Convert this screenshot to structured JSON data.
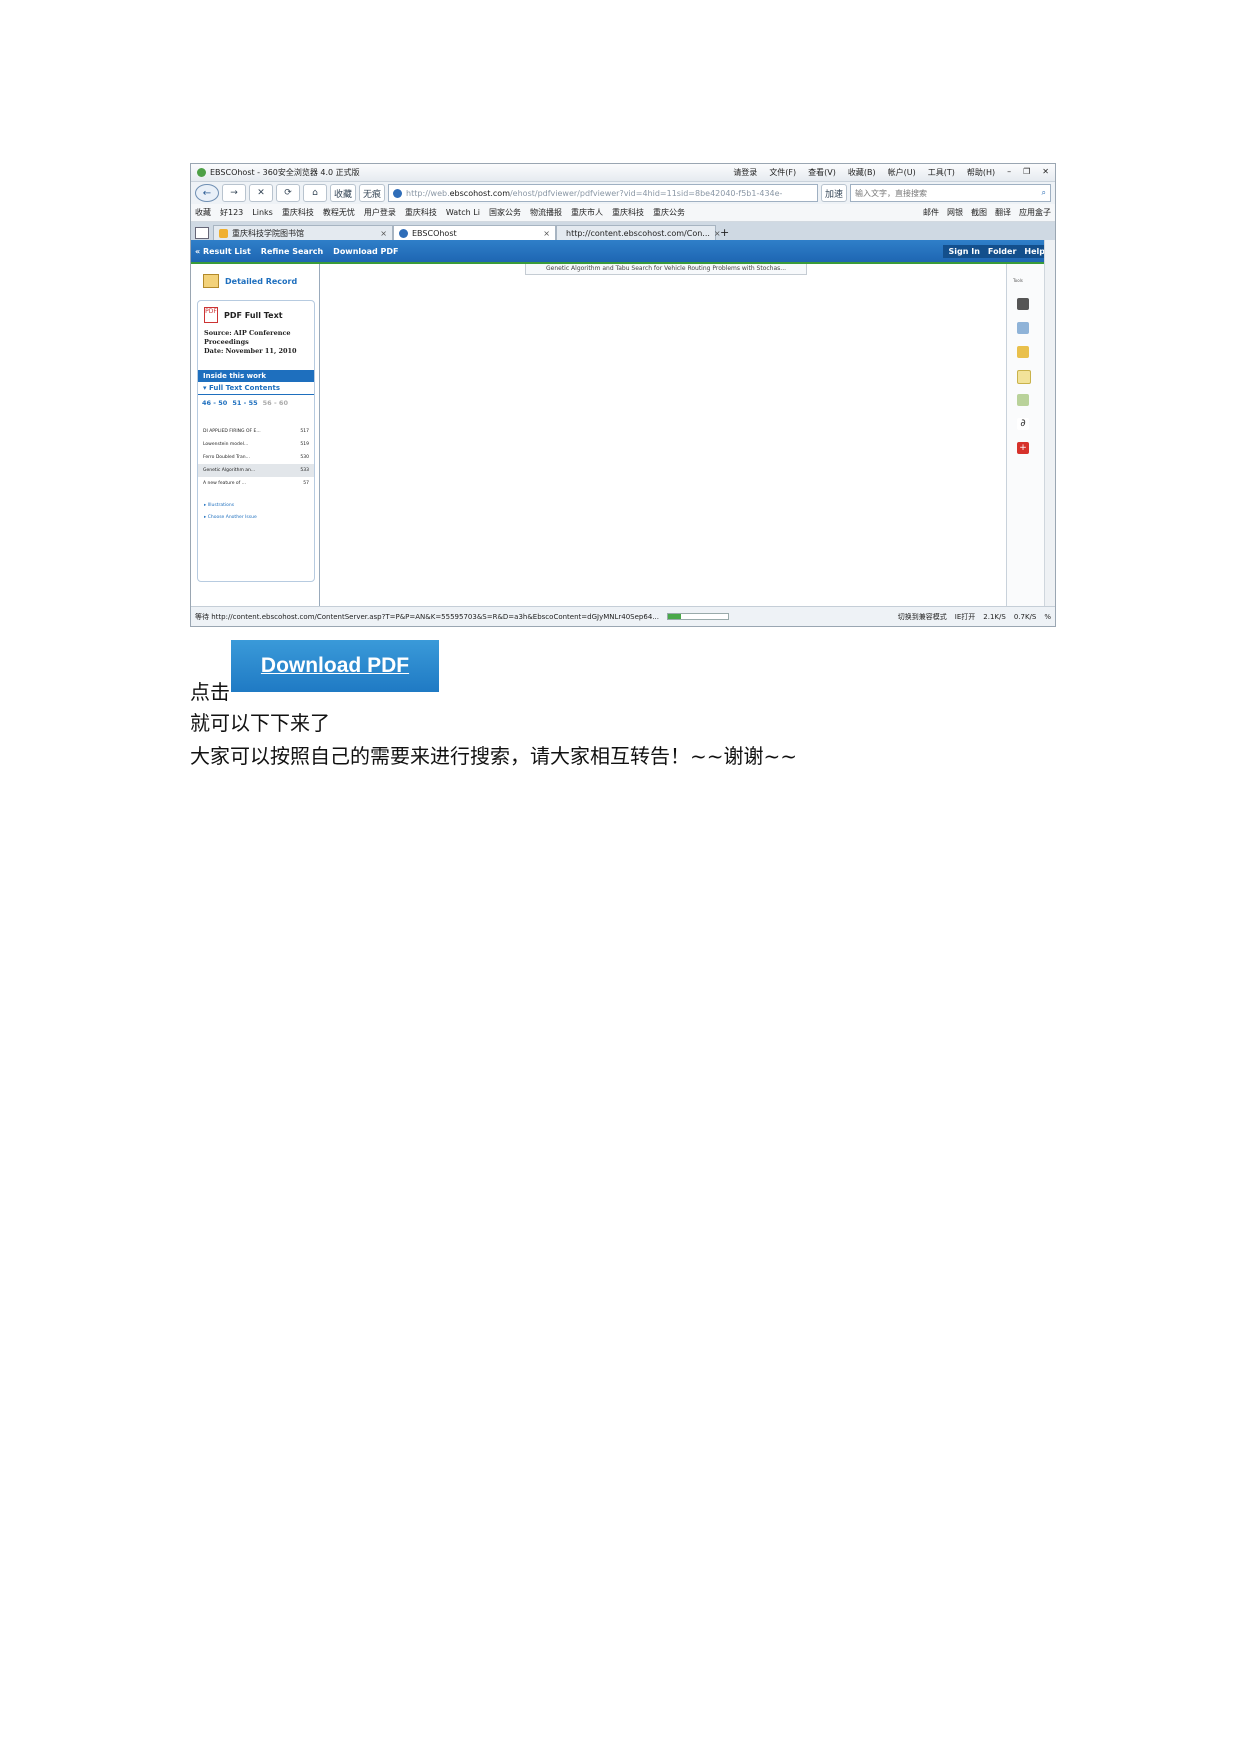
{
  "browser": {
    "window_title": "EBSCOhost - 360安全浏览器 4.0 正式版",
    "menus": [
      "请登录",
      "文件(F)",
      "查看(V)",
      "收藏(B)",
      "帐户(U)",
      "工具(T)",
      "帮助(H)"
    ],
    "nav": {
      "favorites": "收藏",
      "nonscript": "无痕"
    },
    "url": "http://web.",
    "url_host": "ebscohost.com",
    "url_path": "/ehost/pdfviewer/pdfviewer?vid=4hid=11sid=8be42040-f5b1-434e-",
    "accelerate": "加速",
    "search_placeholder": "输入文字，直接搜索",
    "bookmarks": [
      "收藏",
      "好123",
      "Links",
      "重庆科技",
      "教程无忧",
      "用户登录",
      "重庆科技",
      "Watch Li",
      "国家公务",
      "物流播报",
      "重庆市人",
      "重庆科技",
      "重庆公务"
    ],
    "bookmarks_right": [
      "邮件",
      "网银",
      "截图",
      "翻译",
      "应用盒子"
    ],
    "tabs": [
      {
        "label": "重庆科技学院图书馆"
      },
      {
        "label": "EBSCOhost"
      },
      {
        "label": "http://content.ebscohost.com/Con..."
      }
    ],
    "status": {
      "text": "等待 http://content.ebscohost.com/ContentServer.asp?T=P&P=AN&K=55595703&S=R&D=a3h&EbscoContent=dGJyMNLr40Sep64...",
      "progress": 0.22,
      "mode": "切换到兼容模式",
      "ie_open": "IE打开",
      "download": "2.1K/S",
      "upload": "0.7K/S",
      "zoom": "%"
    }
  },
  "ebsco": {
    "toolbar": [
      "« Result List",
      "Refine Search",
      "Download PDF"
    ],
    "toolbar_right": [
      "Sign In",
      "Folder",
      "Help"
    ],
    "detailed_record": "Detailed Record",
    "pdf_full_text": "PDF Full Text",
    "source_label": "Source:",
    "source_value": "AIP Conference Proceedings",
    "date_label": "Date:",
    "date_value": "November 11, 2010",
    "inside_this_work": "Inside this work",
    "full_text_contents": "▾ Full Text Contents",
    "pages": [
      "46 - 50",
      "51 - 55",
      "56 - 60"
    ],
    "toc": [
      {
        "title": "DI APPLIED FIRING OF E...",
        "page": "517"
      },
      {
        "title": "Lowenstein model...",
        "page": "519"
      },
      {
        "title": "Ferro Doubled Tran...",
        "page": "530"
      },
      {
        "title": "Genetic Algorithm an...",
        "page": "533"
      },
      {
        "title": "A new feature of ...",
        "page": "57"
      }
    ],
    "illustrations": "Illustrations",
    "choose_issue": "Choose Another Issue",
    "doc_title": "Genetic Algorithm and Tabu Search for Vehicle Routing Problems with Stochas...",
    "tools_label": "Tools"
  },
  "caption": {
    "click": "点击",
    "download_button": "Download PDF",
    "line2": "就可以下下来了",
    "line3": "大家可以按照自己的需要来进行搜索，请大家相互转告！~~谢谢~~"
  },
  "colors": {
    "ebsco_blue": "#1e6fbe",
    "accent_green": "#3a9b3a",
    "button_blue": "#2a8bd0"
  }
}
